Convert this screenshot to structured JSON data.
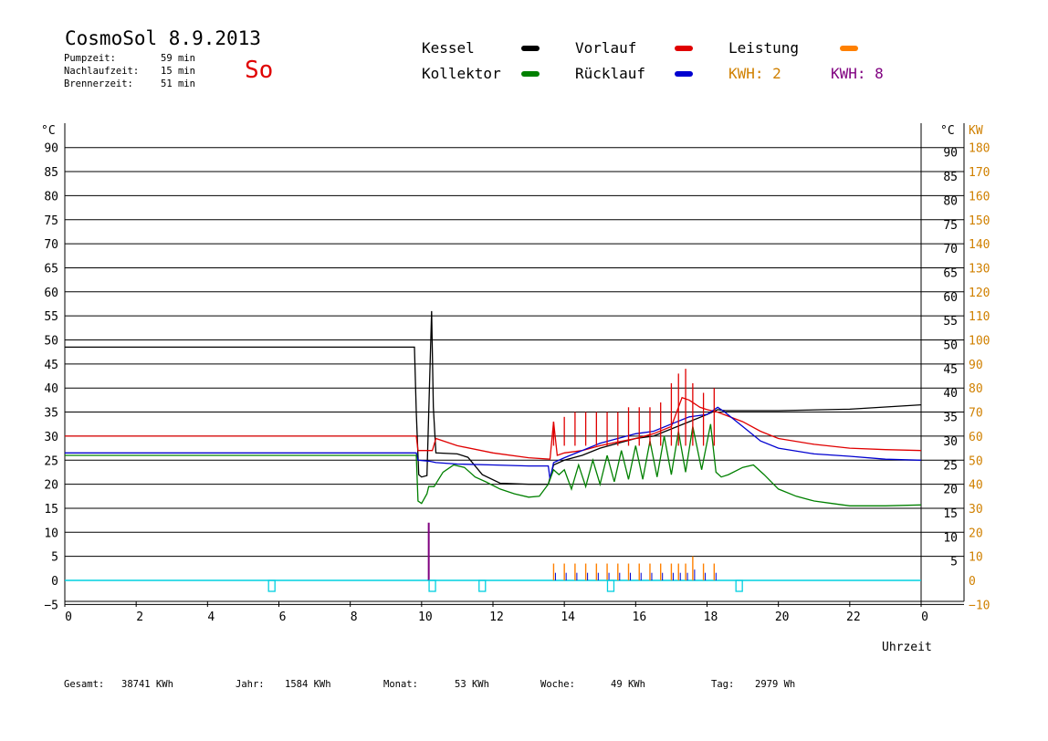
{
  "header": {
    "title": "CosmoSol 8.9.2013",
    "day": "So",
    "stats": [
      {
        "label": "Pumpzeit:",
        "value": "59 min"
      },
      {
        "label": "Nachlaufzeit:",
        "value": "15 min"
      },
      {
        "label": "Brennerzeit:",
        "value": "51 min"
      }
    ]
  },
  "legend": {
    "kessel": "Kessel",
    "kollektor": "Kollektor",
    "vorlauf": "Vorlauf",
    "ruecklauf": "Rücklauf",
    "leistung": "Leistung",
    "kwh_orange": "KWH: 2",
    "kwh_purple": "KWH: 8"
  },
  "colors": {
    "kessel": "#000000",
    "kollektor": "#008000",
    "vorlauf": "#e00000",
    "ruecklauf": "#0000d0",
    "leistung": "#ff8000",
    "kwh_purple": "#800080",
    "pump": "#00d0e0",
    "kw_axis": "#d08000"
  },
  "footer": [
    {
      "label": "Gesamt:",
      "value": "38741 KWh"
    },
    {
      "label": "Jahr:",
      "value": "1584 KWh"
    },
    {
      "label": "Monat:",
      "value": "53 KWh"
    },
    {
      "label": "Woche:",
      "value": "49 KWh"
    },
    {
      "label": "Tag:",
      "value": "2979 Wh"
    }
  ],
  "chart_data": {
    "type": "line",
    "xlabel": "Uhrzeit",
    "ylabel_left": "°C",
    "ylabel_right_celsius": "°C",
    "ylabel_right_kw": "KW",
    "xlim": [
      0,
      24
    ],
    "ylim": [
      -5,
      95
    ],
    "x_ticks": [
      "0",
      "2",
      "4",
      "6",
      "8",
      "10",
      "12",
      "14",
      "16",
      "18",
      "20",
      "22",
      "0"
    ],
    "y_ticks_left": [
      "90",
      "85",
      "80",
      "75",
      "70",
      "65",
      "60",
      "55",
      "50",
      "45",
      "40",
      "35",
      "30",
      "25",
      "20",
      "15",
      "10",
      "5",
      "0",
      "−5"
    ],
    "y_ticks_right_celsius": [
      "90",
      "85",
      "80",
      "75",
      "70",
      "65",
      "60",
      "55",
      "50",
      "45",
      "40",
      "35",
      "30",
      "25",
      "20",
      "15",
      "10",
      "5"
    ],
    "y_ticks_right_kw": [
      "180",
      "170",
      "160",
      "150",
      "140",
      "130",
      "120",
      "110",
      "100",
      "90",
      "80",
      "70",
      "60",
      "50",
      "40",
      "30",
      "20",
      "10",
      "0",
      "−10"
    ],
    "grid": "horizontal",
    "series": [
      {
        "name": "Kessel",
        "color": "#000000",
        "points": [
          [
            0,
            48.5
          ],
          [
            9.8,
            48.5
          ],
          [
            9.85,
            35
          ],
          [
            9.92,
            22
          ],
          [
            10,
            21.5
          ],
          [
            10.15,
            21.8
          ],
          [
            10.22,
            40
          ],
          [
            10.28,
            56
          ],
          [
            10.33,
            36
          ],
          [
            10.4,
            26.5
          ],
          [
            11,
            26.3
          ],
          [
            11.3,
            25.6
          ],
          [
            11.7,
            22
          ],
          [
            12.2,
            20.2
          ],
          [
            13,
            20
          ],
          [
            13.55,
            20
          ],
          [
            13.7,
            24
          ],
          [
            14,
            25
          ],
          [
            14.5,
            26
          ],
          [
            15,
            27.5
          ],
          [
            15.5,
            28.5
          ],
          [
            16,
            29.5
          ],
          [
            16.5,
            30
          ],
          [
            17,
            31.5
          ],
          [
            17.5,
            33
          ],
          [
            18,
            34.5
          ],
          [
            18.3,
            35.5
          ],
          [
            18.5,
            35.3
          ],
          [
            20,
            35.3
          ],
          [
            22,
            35.6
          ],
          [
            24,
            36.5
          ]
        ]
      },
      {
        "name": "Vorlauf",
        "color": "#e00000",
        "points": [
          [
            0,
            30
          ],
          [
            9.85,
            30
          ],
          [
            9.9,
            27
          ],
          [
            10.3,
            27
          ],
          [
            10.4,
            29.5
          ],
          [
            11,
            28
          ],
          [
            12,
            26.5
          ],
          [
            13,
            25.5
          ],
          [
            13.6,
            25.2
          ],
          [
            13.7,
            33
          ],
          [
            13.8,
            26
          ],
          [
            14,
            26.5
          ],
          [
            14.5,
            27
          ],
          [
            15,
            28
          ],
          [
            15.5,
            28.8
          ],
          [
            16,
            29.5
          ],
          [
            16.5,
            30.5
          ],
          [
            17,
            32
          ],
          [
            17.3,
            38
          ],
          [
            17.5,
            37.5
          ],
          [
            17.8,
            36
          ],
          [
            18,
            35.5
          ],
          [
            18.3,
            35
          ],
          [
            19,
            33
          ],
          [
            19.5,
            31
          ],
          [
            20,
            29.5
          ],
          [
            21,
            28.3
          ],
          [
            22,
            27.5
          ],
          [
            23,
            27.2
          ],
          [
            24,
            27
          ]
        ]
      },
      {
        "name": "Rücklauf",
        "color": "#0000d0",
        "points": [
          [
            0,
            26.5
          ],
          [
            9.85,
            26.5
          ],
          [
            9.9,
            25
          ],
          [
            10.2,
            24.8
          ],
          [
            10.4,
            24.5
          ],
          [
            11,
            24.2
          ],
          [
            12,
            24
          ],
          [
            13,
            23.8
          ],
          [
            13.55,
            23.8
          ],
          [
            13.6,
            21
          ],
          [
            13.7,
            24.5
          ],
          [
            14,
            25.5
          ],
          [
            14.5,
            27
          ],
          [
            15,
            28.5
          ],
          [
            15.5,
            29.5
          ],
          [
            16,
            30.5
          ],
          [
            16.5,
            31
          ],
          [
            17,
            32.5
          ],
          [
            17.5,
            34
          ],
          [
            18,
            34.5
          ],
          [
            18.3,
            36
          ],
          [
            18.5,
            35
          ],
          [
            19,
            32
          ],
          [
            19.5,
            29
          ],
          [
            20,
            27.5
          ],
          [
            21,
            26.3
          ],
          [
            22,
            25.8
          ],
          [
            23,
            25.2
          ],
          [
            24,
            25
          ]
        ]
      },
      {
        "name": "Kollektor",
        "color": "#008000",
        "points": [
          [
            0,
            26
          ],
          [
            9.85,
            26
          ],
          [
            9.9,
            16.5
          ],
          [
            10,
            16
          ],
          [
            10.15,
            18
          ],
          [
            10.2,
            19.5
          ],
          [
            10.35,
            19.5
          ],
          [
            10.6,
            22.5
          ],
          [
            10.9,
            24
          ],
          [
            11.2,
            23.5
          ],
          [
            11.5,
            21.5
          ],
          [
            11.8,
            20.5
          ],
          [
            12.2,
            19
          ],
          [
            12.6,
            18
          ],
          [
            13,
            17.3
          ],
          [
            13.3,
            17.5
          ],
          [
            13.55,
            20
          ],
          [
            13.7,
            23
          ],
          [
            13.85,
            22
          ],
          [
            14,
            23
          ],
          [
            14.2,
            19
          ],
          [
            14.4,
            24
          ],
          [
            14.6,
            19.5
          ],
          [
            14.8,
            25
          ],
          [
            15,
            20
          ],
          [
            15.2,
            26
          ],
          [
            15.4,
            20.5
          ],
          [
            15.6,
            27
          ],
          [
            15.8,
            21
          ],
          [
            16,
            28
          ],
          [
            16.2,
            21
          ],
          [
            16.4,
            29
          ],
          [
            16.6,
            21.5
          ],
          [
            16.8,
            30
          ],
          [
            17,
            22
          ],
          [
            17.2,
            31
          ],
          [
            17.4,
            22.5
          ],
          [
            17.6,
            32
          ],
          [
            17.85,
            23
          ],
          [
            18.1,
            32.5
          ],
          [
            18.25,
            22.5
          ],
          [
            18.4,
            21.5
          ],
          [
            18.6,
            22
          ],
          [
            19,
            23.5
          ],
          [
            19.3,
            24
          ],
          [
            19.6,
            22
          ],
          [
            20,
            19
          ],
          [
            20.5,
            17.5
          ],
          [
            21,
            16.5
          ],
          [
            21.5,
            16
          ],
          [
            22,
            15.5
          ],
          [
            23,
            15.5
          ],
          [
            24,
            15.7
          ]
        ]
      }
    ],
    "leistung_peaks_x": [
      13.7,
      14,
      14.3,
      14.6,
      14.9,
      15.2,
      15.5,
      15.8,
      16.1,
      16.4,
      16.7,
      17.0,
      17.2,
      17.4,
      17.6,
      17.9,
      18.2
    ],
    "power_spike": {
      "x": 10.2,
      "kw": 24
    },
    "pump_markers_x": [
      5.8,
      10.3,
      11.7,
      15.3,
      18.9
    ]
  }
}
